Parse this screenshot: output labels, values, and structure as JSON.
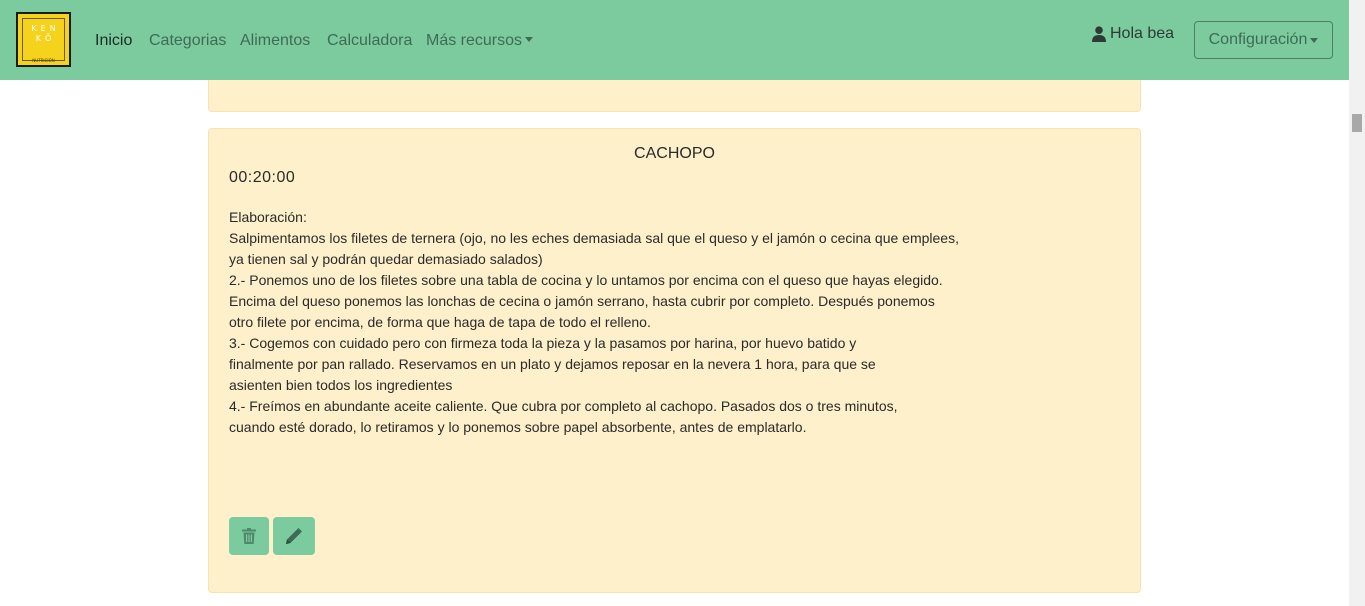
{
  "brand": {
    "logo_line1": "KEN",
    "logo_line2": "KŌ",
    "logo_sub": "NUTRICIÓN"
  },
  "nav": {
    "items": [
      {
        "label": "Inicio"
      },
      {
        "label": "Categorias"
      },
      {
        "label": "Alimentos"
      },
      {
        "label": "Calculadora"
      },
      {
        "label": "Más recursos"
      }
    ],
    "user_label": "Hola bea",
    "config_label": "Configuración"
  },
  "recipe": {
    "title": "CACHOPO",
    "time": "00:20:00",
    "lines": [
      "Elaboración:",
      "Salpimentamos los filetes de ternera (ojo, no les eches demasiada sal que el queso y el jamón o cecina que emplees,",
      "ya tienen sal y podrán quedar demasiado salados)",
      "2.- Ponemos uno de los filetes sobre una tabla de cocina y lo untamos por encima con el queso que hayas elegido.",
      "Encima del queso ponemos las lonchas de cecina o jamón serrano, hasta cubrir por completo. Después ponemos",
      "otro filete por encima, de forma que haga de tapa de todo el relleno.",
      "3.- Cogemos con cuidado pero con firmeza toda la pieza y la pasamos por harina, por huevo batido y",
      "finalmente por pan rallado. Reservamos en un plato y dejamos reposar en la nevera 1 hora, para que se",
      "asienten bien todos los ingredientes",
      "4.- Freímos en abundante aceite caliente. Que cubra por completo al cachopo. Pasados dos o tres minutos,",
      "cuando esté dorado, lo retiramos y lo ponemos sobre papel absorbente, antes de emplatarlo."
    ]
  },
  "colors": {
    "navbar": "#7bcb9f",
    "card": "#fef0ca",
    "button": "#7bcb9f",
    "logo": "#f5d31c"
  },
  "icons": {
    "user": "user-icon",
    "delete": "trash-icon",
    "edit": "pencil-icon"
  }
}
